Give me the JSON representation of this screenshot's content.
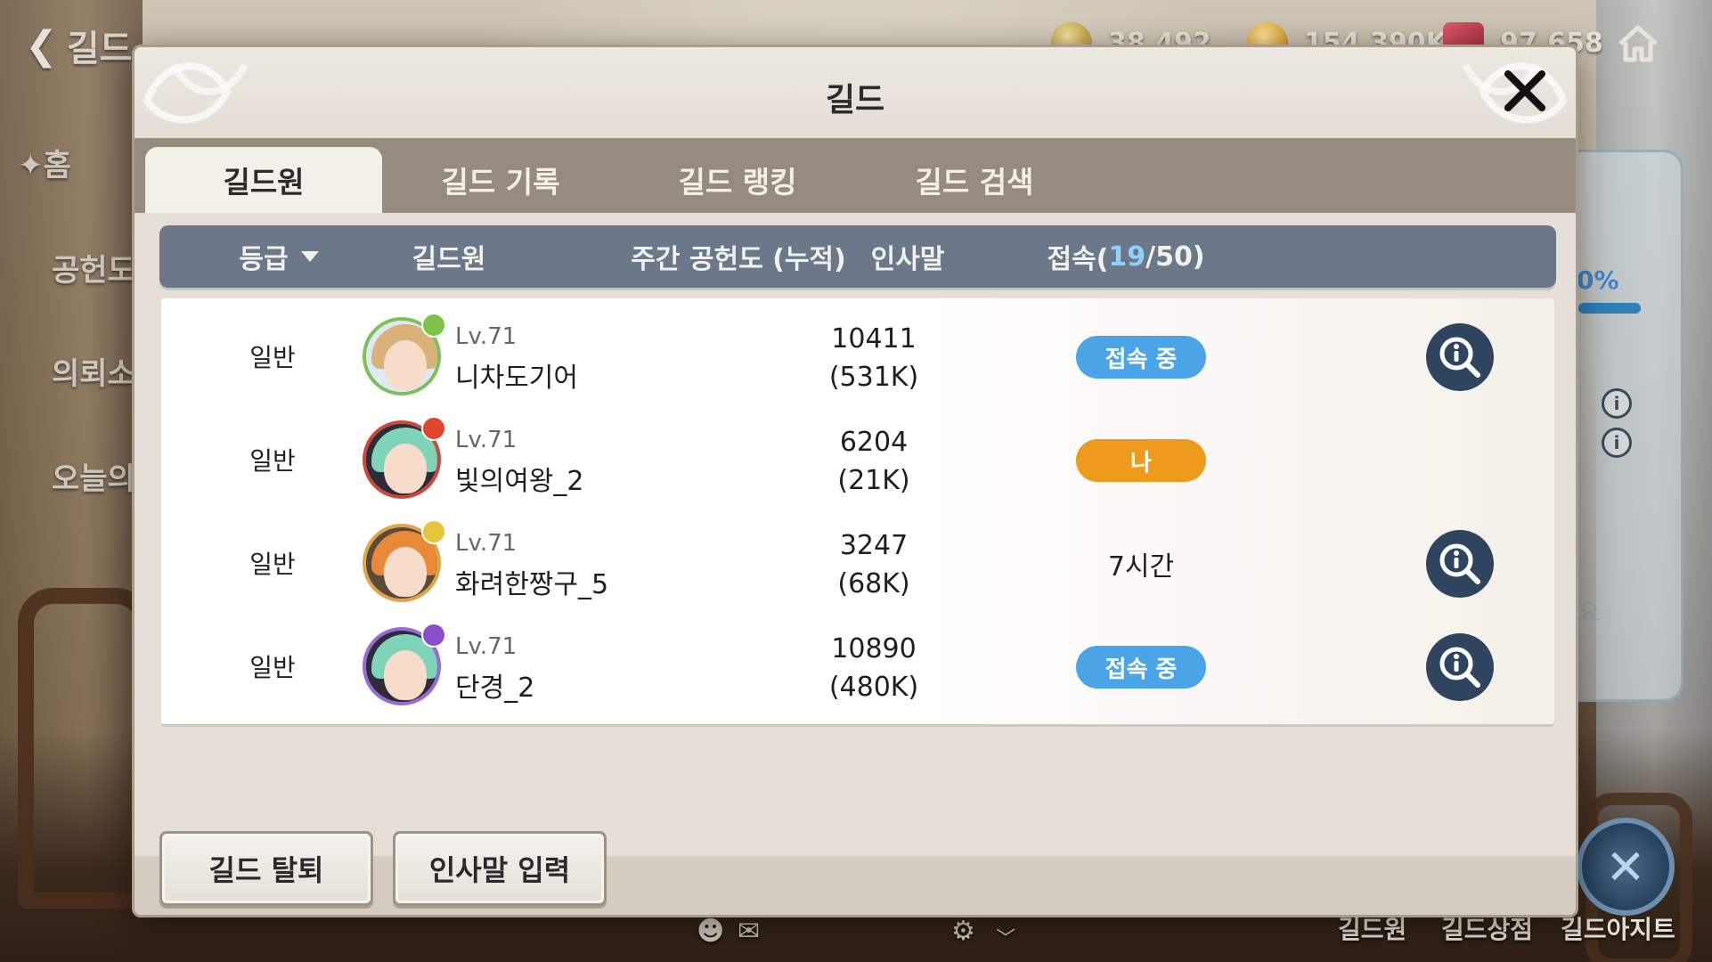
{
  "hud": {
    "back_label": "길드",
    "currencies": [
      {
        "icon": "gem-icon",
        "value": "38,492"
      },
      {
        "icon": "gold-coin-icon",
        "value": "154,390K"
      },
      {
        "icon": "ticket-icon",
        "value": "97,658"
      }
    ],
    "home_icon": "home-icon"
  },
  "sidebar": {
    "items": [
      {
        "label": "✦홈"
      },
      {
        "label": "공헌도"
      },
      {
        "label": "의뢰소"
      },
      {
        "label": "오늘의"
      }
    ]
  },
  "behind": {
    "percent": "0%",
    "suffix": "요"
  },
  "bottom_nav": {
    "items": [
      "길드원",
      "길드상점",
      "길드아지트"
    ]
  },
  "dialog": {
    "title": "길드",
    "close_icon": "close-icon",
    "tabs": [
      {
        "label": "길드원",
        "active": true
      },
      {
        "label": "길드 기록",
        "active": false
      },
      {
        "label": "길드 랭킹",
        "active": false
      },
      {
        "label": "길드 검색",
        "active": false
      }
    ],
    "columns": {
      "grade": "등급",
      "grade_sort_icon": "sort-down-icon",
      "member": "길드원",
      "contribution": "주간 공헌도 (누적)",
      "greeting": "인사말",
      "access_prefix": "접속(",
      "access_online": "19",
      "access_suffix": "/50)"
    },
    "members": [
      {
        "grade": "일반",
        "level": "Lv.71",
        "name": "니차도기어",
        "weekly": "10411",
        "total": "(531K)",
        "status": "접속 중",
        "status_type": "online",
        "has_detail": true,
        "hair_color": "#d8b27a",
        "badge_color": "#7fc24a",
        "ring_color": "#7fbf5a"
      },
      {
        "grade": "일반",
        "level": "Lv.71",
        "name": "빛의여왕_2",
        "weekly": "6204",
        "total": "(21K)",
        "status": "나",
        "status_type": "me",
        "has_detail": false,
        "hair_color": "#7fd3b8",
        "badge_color": "#e0452e",
        "ring_color": "#c94a3a"
      },
      {
        "grade": "일반",
        "level": "Lv.71",
        "name": "화려한짱구_5",
        "weekly": "3247",
        "total": "(68K)",
        "status": "7시간",
        "status_type": "text",
        "has_detail": true,
        "hair_color": "#e8893a",
        "badge_color": "#e7c43a",
        "ring_color": "#e0a44a"
      },
      {
        "grade": "일반",
        "level": "Lv.71",
        "name": "단경_2",
        "weekly": "10890",
        "total": "(480K)",
        "status": "접속 중",
        "status_type": "online",
        "has_detail": true,
        "hair_color": "#7fd3b8",
        "badge_color": "#8a4fc8",
        "ring_color": "#9a6ad0"
      }
    ],
    "footer_buttons": {
      "leave": "길드 탈퇴",
      "greeting_input": "인사말 입력"
    }
  }
}
